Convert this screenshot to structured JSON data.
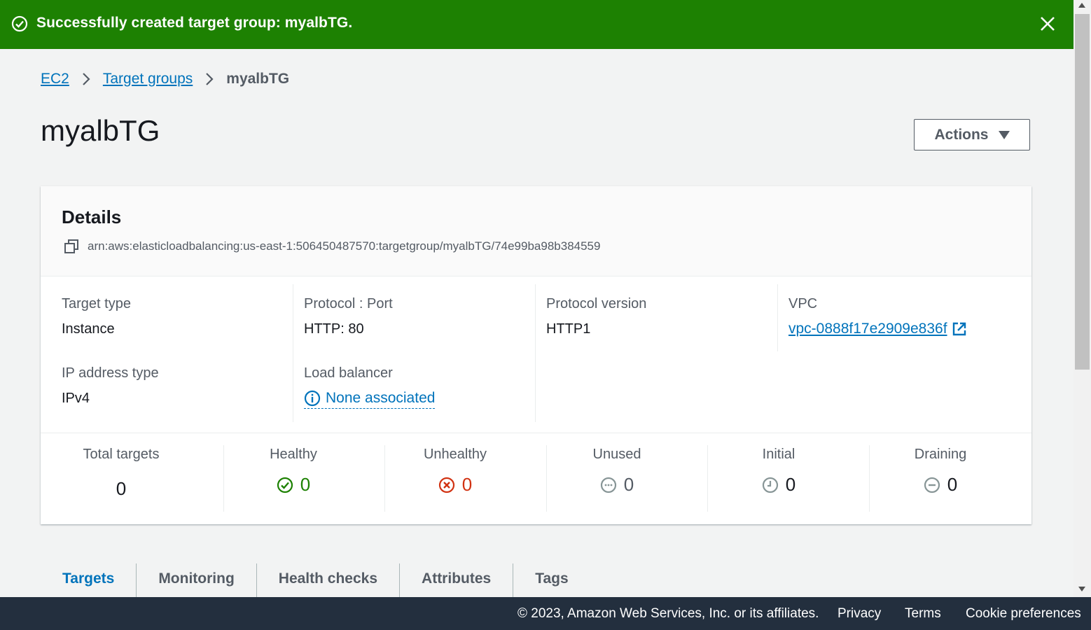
{
  "banner": {
    "message": "Successfully created target group: myalbTG.",
    "color": "#1d8102"
  },
  "breadcrumb": {
    "items": [
      "EC2",
      "Target groups"
    ],
    "current": "myalbTG"
  },
  "page": {
    "title": "myalbTG",
    "actions_label": "Actions"
  },
  "details": {
    "heading": "Details",
    "arn": "arn:aws:elasticloadbalancing:us-east-1:506450487570:targetgroup/myalbTG/74e99ba98b384559",
    "target_type_label": "Target type",
    "target_type": "Instance",
    "protocol_port_label": "Protocol : Port",
    "protocol_port": "HTTP: 80",
    "protocol_version_label": "Protocol version",
    "protocol_version": "HTTP1",
    "vpc_label": "VPC",
    "vpc": "vpc-0888f17e2909e836f",
    "ip_address_type_label": "IP address type",
    "ip_address_type": "IPv4",
    "load_balancer_label": "Load balancer",
    "load_balancer": "None associated"
  },
  "stats": [
    {
      "label": "Total targets",
      "value": "0",
      "icon": "",
      "color": "#16191f"
    },
    {
      "label": "Healthy",
      "value": "0",
      "icon": "check-circle-icon",
      "color": "#1d8102"
    },
    {
      "label": "Unhealthy",
      "value": "0",
      "icon": "x-circle-icon",
      "color": "#d13212"
    },
    {
      "label": "Unused",
      "value": "0",
      "icon": "ellipsis-circle-icon",
      "color": "#16191f"
    },
    {
      "label": "Initial",
      "value": "0",
      "icon": "clock-icon",
      "color": "#16191f"
    },
    {
      "label": "Draining",
      "value": "0",
      "icon": "minus-circle-icon",
      "color": "#16191f"
    }
  ],
  "tabs": [
    "Targets",
    "Monitoring",
    "Health checks",
    "Attributes",
    "Tags"
  ],
  "footer": {
    "copyright": "© 2023, Amazon Web Services, Inc. or its affiliates.",
    "privacy": "Privacy",
    "terms": "Terms",
    "cookies": "Cookie preferences"
  }
}
